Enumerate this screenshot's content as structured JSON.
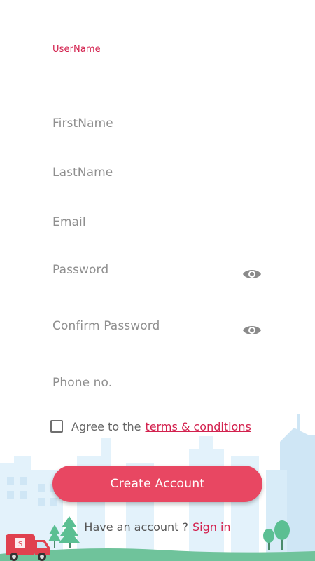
{
  "form": {
    "username": {
      "label": "UserName",
      "value": ""
    },
    "firstname": {
      "placeholder": "FirstName"
    },
    "lastname": {
      "placeholder": "LastName"
    },
    "email": {
      "placeholder": "Email"
    },
    "password": {
      "placeholder": "Password",
      "toggle_icon": "eye-icon"
    },
    "confirm_password": {
      "placeholder": "Confirm Password",
      "toggle_icon": "eye-icon"
    },
    "phone": {
      "placeholder": "Phone no."
    }
  },
  "agree": {
    "checked": false,
    "text": "Agree to the",
    "link": "terms & conditions"
  },
  "create_button": "Create Account",
  "signin_prompt": {
    "text": "Have an account ?",
    "link": "Sign in"
  },
  "colors": {
    "accent": "#d3214e",
    "button": "#e84762",
    "skyline": "#d6ecf8"
  },
  "illustration": {
    "van_label": "S"
  }
}
